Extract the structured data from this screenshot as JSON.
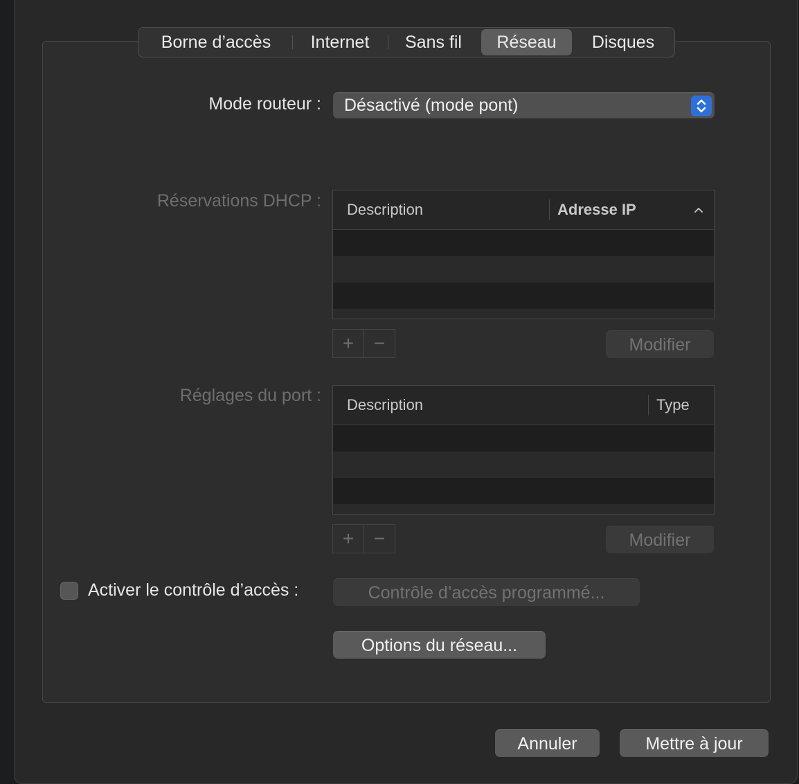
{
  "tabs": [
    {
      "label": "Borne d’accès"
    },
    {
      "label": "Internet"
    },
    {
      "label": "Sans fil"
    },
    {
      "label": "Réseau"
    },
    {
      "label": "Disques"
    }
  ],
  "active_tab": "Réseau",
  "router_mode": {
    "label": "Mode routeur :",
    "value": "Désactivé (mode pont)"
  },
  "dhcp": {
    "label": "Réservations DHCP :",
    "columns": [
      "Description",
      "Adresse IP"
    ],
    "sort_icon": "chevron-up-icon",
    "add": "+",
    "remove": "−",
    "modify": "Modifier"
  },
  "ports": {
    "label": "Réglages du port :",
    "columns": [
      "Description",
      "Type"
    ],
    "add": "+",
    "remove": "−",
    "modify": "Modifier"
  },
  "access_control": {
    "label": "Activer le contrôle d’accès :",
    "button": "Contrôle d’accès programmé..."
  },
  "network_options": "Options du réseau...",
  "footer": {
    "cancel": "Annuler",
    "update": "Mettre à jour"
  },
  "colors": {
    "accent": "#2f6fd8",
    "window_bg": "#282828"
  }
}
